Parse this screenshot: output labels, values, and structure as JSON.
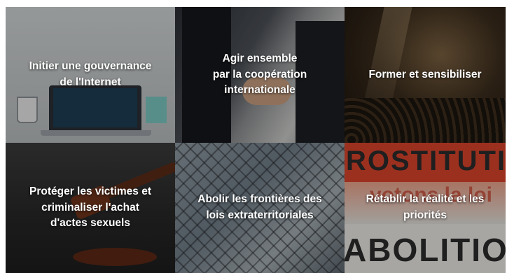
{
  "tiles": [
    {
      "id": "gouvernance",
      "label": "Initier une gouvernance\nde l'Internet"
    },
    {
      "id": "cooperation",
      "label": "Agir ensemble\npar la coopération\ninternationale"
    },
    {
      "id": "former",
      "label": "Former et sensibiliser"
    },
    {
      "id": "proteger",
      "label": "Protéger les victimes et\ncriminaliser l'achat\nd'actes sexuels"
    },
    {
      "id": "frontieres",
      "label": "Abolir les frontières des\nlois extraterritoriales"
    },
    {
      "id": "realite",
      "label": "Rétablir la réalité et les\npriorités"
    }
  ],
  "banner": {
    "line_top": "ROSTITUTIO",
    "line_mid": "votons la loi",
    "line_bottom": "ABOLITIO"
  }
}
